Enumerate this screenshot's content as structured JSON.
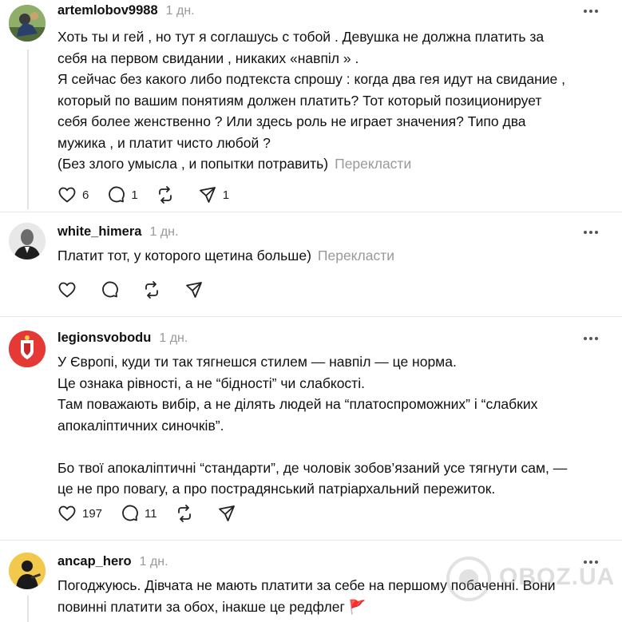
{
  "comments": [
    {
      "username": "artemlobov9988",
      "time": "1 дн.",
      "lines": [
        "Хоть ты и гей , но тут я соглашусь с тобой . Девушка не должна платить за",
        "себя на первом свидании , никаких «навпіл » .",
        "Я сейчас без какого либо подтекста спрошу : когда два гея идут на свидание ,",
        "который по вашим понятиям должен платить? Тот который позиционирует",
        "себя более женственно ? Или здесь роль не играет значения? Типо два",
        "мужика , и платит чисто любой ?",
        "(Без злого умысла , и попытки потравить)"
      ],
      "translate": "Перекласти",
      "likes": "6",
      "replies": "1",
      "reposts": "",
      "shares": "1"
    },
    {
      "username": "white_himera",
      "time": "1 дн.",
      "lines": [
        "Платит тот, у которого щетина больше)"
      ],
      "translate": "Перекласти",
      "likes": "",
      "replies": "",
      "reposts": "",
      "shares": ""
    },
    {
      "username": "legionsvobodu",
      "time": "1 дн.",
      "lines": [
        "У Європі, куди ти так тягнешся стилем — навпіл — це норма.",
        "Це ознака рівності, а не “бідності” чи слабкості.",
        "Там поважають вибір, а не ділять людей на “платоспроможних” і “слабких",
        "апокаліптичних синочків”.",
        "",
        "Бо твої апокаліптичні “стандарти”, де чоловік зобов’язаний усе тягнути сам, —",
        "це не про повагу, а про пострадянський патріархальний пережиток."
      ],
      "likes": "197",
      "replies": "11",
      "reposts": "",
      "shares": ""
    },
    {
      "username": "ancap_hero",
      "time": "1 дн.",
      "lines": [
        "Погоджуюсь. Дівчата не мають платити за себе на першому побаченні. Вони",
        "повинні платити за обох, інакше це редфлег 🚩"
      ]
    }
  ],
  "watermark": "OBOZ.UA",
  "colors": {
    "text": "#101010",
    "muted": "#999999",
    "divider": "#e6e6e6",
    "flag": "#e53935"
  },
  "icons": [
    "heart-icon",
    "comment-icon",
    "repost-icon",
    "share-icon",
    "more-icon"
  ]
}
